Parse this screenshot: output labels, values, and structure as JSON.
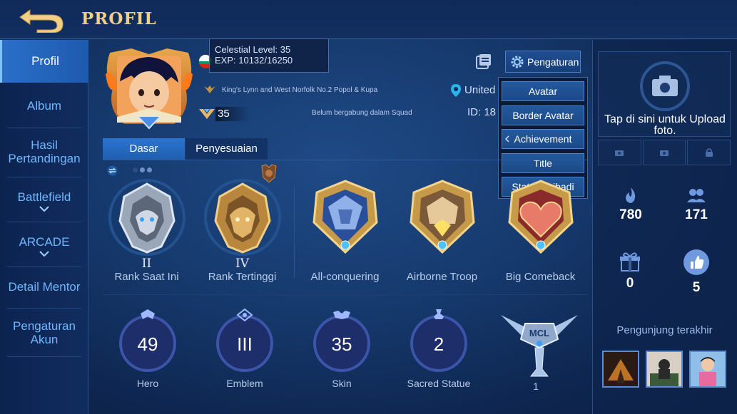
{
  "header": {
    "title": "PROFIL"
  },
  "sidebar": {
    "items": [
      {
        "label": "Profil"
      },
      {
        "label": "Album"
      },
      {
        "label": "Hasil Pertandingan"
      },
      {
        "label": "Battlefield"
      },
      {
        "label": "ARCADE"
      },
      {
        "label": "Detail Mentor"
      },
      {
        "label": "Pengaturan Akun"
      }
    ]
  },
  "profile": {
    "tooltip_line1": "Celestial Level: 35",
    "tooltip_line2": "EXP: 10132/16250",
    "server": "King's Lynn and West Norfolk No.2 Popol & Kupa",
    "level": "35",
    "squad": "Belum bergabung dalam Squad",
    "location": "United",
    "id": "ID: 18"
  },
  "settings_button": "Pengaturan",
  "dropdown": [
    "Avatar",
    "Border Avatar",
    "Achievement",
    "Title",
    "Status Pribadi"
  ],
  "tabs": [
    "Dasar",
    "Penyesuaian"
  ],
  "medals": [
    {
      "rank": "II",
      "label": "Rank Saat Ini"
    },
    {
      "rank": "IV",
      "label": "Rank Tertinggi"
    },
    {
      "rank": "",
      "label": "All-conquering"
    },
    {
      "rank": "",
      "label": "Airborne Troop"
    },
    {
      "rank": "",
      "label": "Big Comeback"
    }
  ],
  "stats": [
    {
      "value": "49",
      "label": "Hero"
    },
    {
      "value": "III",
      "label": "Emblem"
    },
    {
      "value": "35",
      "label": "Skin"
    },
    {
      "value": "2",
      "label": "Sacred Statue"
    },
    {
      "value": "",
      "label": "1"
    }
  ],
  "mcl_badge": "MCL",
  "right_panel": {
    "upload_text": "Tap di sini untuk Upload foto.",
    "popularity": "780",
    "followers": "171",
    "gifts": "0",
    "likes": "5",
    "visitor_title": "Pengunjung terakhir"
  },
  "colors": {
    "accent_gold": "#f1cf85",
    "sidebar_text": "#6fb8ff",
    "active_tab": "#2b74cf"
  }
}
